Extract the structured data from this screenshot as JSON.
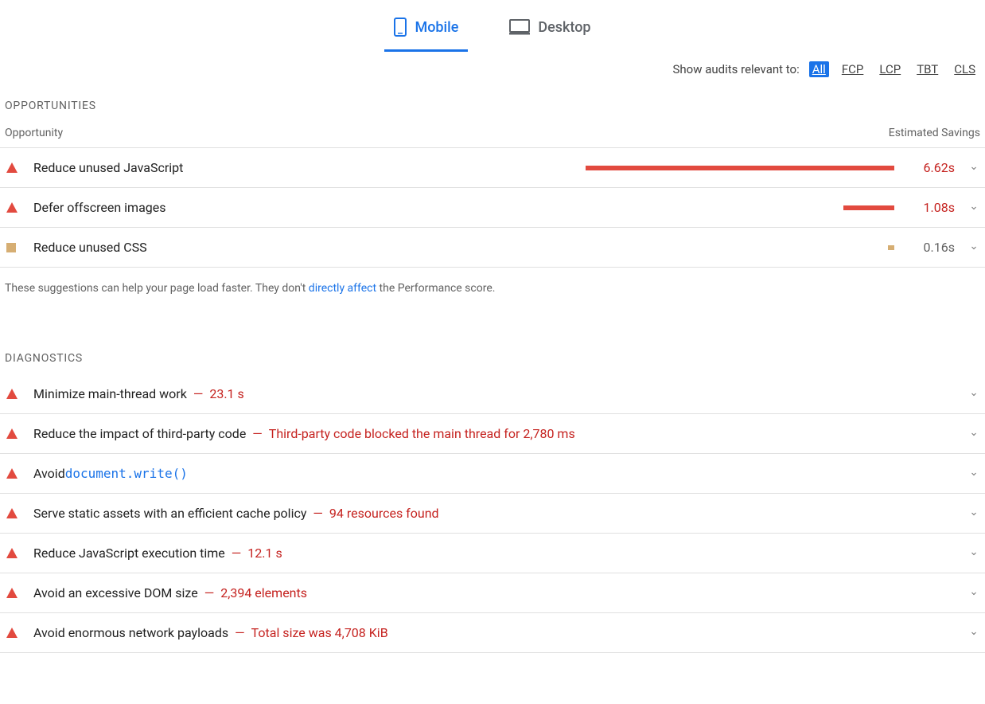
{
  "tabs": {
    "mobile": "Mobile",
    "desktop": "Desktop"
  },
  "filter": {
    "label": "Show audits relevant to:",
    "all": "All",
    "fcp": "FCP",
    "lcp": "LCP",
    "tbt": "TBT",
    "cls": "CLS"
  },
  "opportunities": {
    "heading": "OPPORTUNITIES",
    "col_opportunity": "Opportunity",
    "col_savings": "Estimated Savings",
    "items": [
      {
        "title": "Reduce unused JavaScript",
        "savings": "6.62s",
        "severity": "fail",
        "bar_pct": 97,
        "bar_color": "red"
      },
      {
        "title": "Defer offscreen images",
        "savings": "1.08s",
        "severity": "fail",
        "bar_pct": 16,
        "bar_color": "red"
      },
      {
        "title": "Reduce unused CSS",
        "savings": "0.16s",
        "severity": "avg",
        "bar_pct": 2,
        "bar_color": "tan"
      }
    ],
    "footnote_pre": "These suggestions can help your page load faster. They don't ",
    "footnote_link": "directly affect",
    "footnote_post": " the Performance score."
  },
  "diagnostics": {
    "heading": "DIAGNOSTICS",
    "items": [
      {
        "title": "Minimize main-thread work",
        "detail": "23.1 s",
        "severity": "fail"
      },
      {
        "title": "Reduce the impact of third-party code",
        "detail": "Third-party code blocked the main thread for 2,780 ms",
        "severity": "fail"
      },
      {
        "title": "Avoid ",
        "code": "document.write()",
        "detail": "",
        "severity": "fail"
      },
      {
        "title": "Serve static assets with an efficient cache policy",
        "detail": "94 resources found",
        "severity": "fail"
      },
      {
        "title": "Reduce JavaScript execution time",
        "detail": "12.1 s",
        "severity": "fail"
      },
      {
        "title": "Avoid an excessive DOM size",
        "detail": "2,394 elements",
        "severity": "fail"
      },
      {
        "title": "Avoid enormous network payloads",
        "detail": "Total size was 4,708 KiB",
        "severity": "fail"
      }
    ]
  }
}
